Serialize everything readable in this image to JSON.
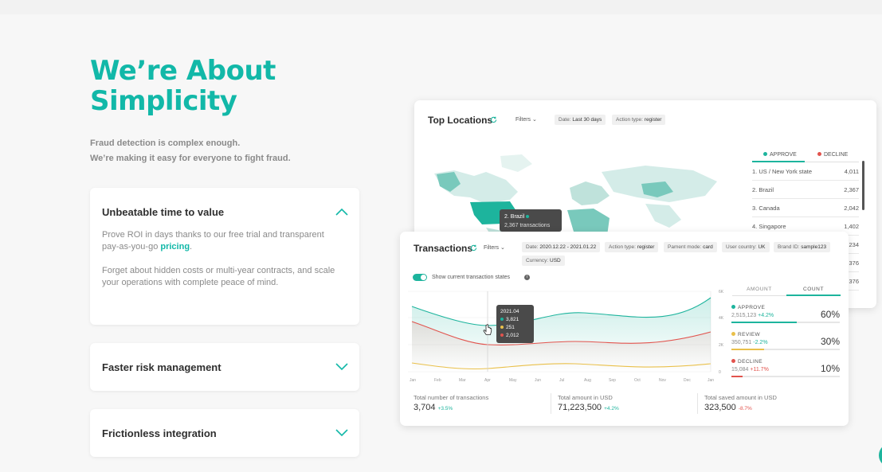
{
  "hero": {
    "title_line1": "We’re About",
    "title_line2": "Simplicity",
    "sub_line1": "Fraud detection is complex enough.",
    "sub_line2": "We’re making it easy for everyone to fight fraud."
  },
  "accordion": {
    "items": [
      {
        "title": "Unbeatable time to value",
        "expanded": true,
        "p1_before": "Prove ROI in days thanks to our free trial and transparent pay-as-you-go ",
        "p1_link": "pricing",
        "p1_after": ".",
        "p2": "Forget about hidden costs or multi-year contracts, and scale your operations with complete peace of mind."
      },
      {
        "title": "Faster risk management",
        "expanded": false
      },
      {
        "title": "Frictionless integration",
        "expanded": false
      }
    ]
  },
  "top_locations": {
    "title": "Top Locations",
    "filters": "Filters",
    "tag_date_label": "Date:",
    "tag_date_value": "Last 30 days",
    "tag_action_label": "Action type:",
    "tag_action_value": "register",
    "tabs": [
      "APPROVE",
      "DECLINE"
    ],
    "tooltip_title": "2. Brazil",
    "tooltip_value": "2,367 transactions",
    "rows": [
      {
        "name": "1. US / New York state",
        "value": "4,011"
      },
      {
        "name": "2. Brazil",
        "value": "2,367"
      },
      {
        "name": "3. Canada",
        "value": "2,042"
      },
      {
        "name": "4. Singapore",
        "value": "1,402"
      },
      {
        "name": "",
        "value": "234"
      },
      {
        "name": "",
        "value": "376"
      },
      {
        "name": "",
        "value": "376"
      }
    ]
  },
  "transactions": {
    "title": "Transactions",
    "filters": "Filters",
    "tags": [
      {
        "label": "Date:",
        "value": "2020.12.22 - 2021.01.22"
      },
      {
        "label": "Action type:",
        "value": "register"
      },
      {
        "label": "Pament mode:",
        "value": "card"
      },
      {
        "label": "User country:",
        "value": "UK"
      },
      {
        "label": "Brand ID:",
        "value": "sample123"
      },
      {
        "label": "Currency:",
        "value": "USD"
      }
    ],
    "toggle_label": "Show current transaction states",
    "info_icon": "i",
    "y_ticks": [
      "6K",
      "4K",
      "2K",
      "0"
    ],
    "months": [
      "Jan",
      "Feb",
      "Mar",
      "Apr",
      "May",
      "Jun",
      "Jul",
      "Aug",
      "Sep",
      "Oct",
      "Nov",
      "Dec",
      "Jan"
    ],
    "tooltip": {
      "title": "2021.04",
      "approve": "3,821",
      "review": "251",
      "decline": "2,012"
    },
    "tabs": [
      "AMOUNT",
      "COUNT"
    ],
    "stats": [
      {
        "title": "APPROVE",
        "value": "2,515,123",
        "delta": "+4.2%",
        "pct": "60%",
        "color": "#1db49d",
        "fill": 0.6
      },
      {
        "title": "REVIEW",
        "value": "350,751",
        "delta": "-2.2%",
        "pct": "30%",
        "color": "#e9c04a",
        "fill": 0.3
      },
      {
        "title": "DECLINE",
        "value": "15,084",
        "delta": "+11.7%",
        "pct": "10%",
        "color": "#e2534d",
        "fill": 0.1
      }
    ],
    "kpis": [
      {
        "label": "Total number of transactions",
        "value": "3,704",
        "delta": "+3.5%"
      },
      {
        "label": "Total amount in USD",
        "value": "71,223,500",
        "delta": "+4.2%"
      },
      {
        "label": "Total saved amount in USD",
        "value": "323,500",
        "delta": "-8.7%"
      }
    ]
  },
  "colors": {
    "brand": "#12b8a8",
    "approve": "#1db49d",
    "review": "#e9c04a",
    "decline": "#e2534d"
  }
}
